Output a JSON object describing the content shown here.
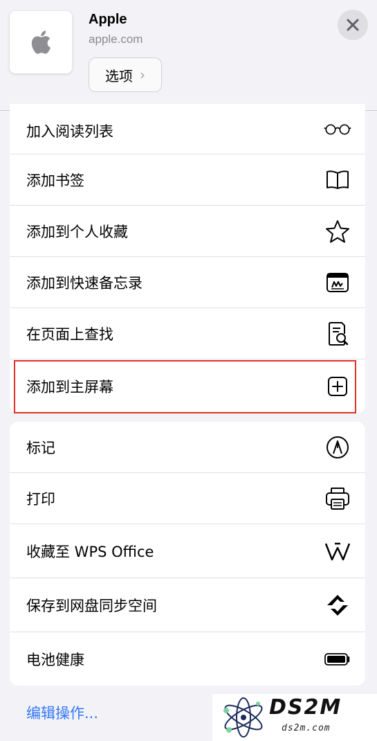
{
  "header": {
    "title": "Apple",
    "url": "apple.com",
    "options_label": "选项",
    "app_icon": "apple-logo-icon",
    "close_icon": "close-icon"
  },
  "menu_group_1": [
    {
      "label": "加入阅读列表",
      "icon": "glasses-icon"
    },
    {
      "label": "添加书签",
      "icon": "book-icon"
    },
    {
      "label": "添加到个人收藏",
      "icon": "star-icon"
    },
    {
      "label": "添加到快速备忘录",
      "icon": "quick-note-icon"
    },
    {
      "label": "在页面上查找",
      "icon": "find-in-page-icon"
    },
    {
      "label": "添加到主屏幕",
      "icon": "plus-square-icon",
      "highlighted": true
    }
  ],
  "menu_group_2": [
    {
      "label": "标记",
      "icon": "markup-pen-icon"
    },
    {
      "label": "打印",
      "icon": "printer-icon"
    },
    {
      "label": "收藏至 WPS Office",
      "icon": "wps-icon"
    },
    {
      "label": "保存到网盘同步空间",
      "icon": "sync-space-icon"
    },
    {
      "label": "电池健康",
      "icon": "battery-icon"
    }
  ],
  "footer": {
    "edit_actions_label": "编辑操作..."
  },
  "watermark": {
    "brand": "DS2M",
    "domain": "ds2m.com"
  },
  "colors": {
    "highlight_border": "#e0302a",
    "link": "#3478f6",
    "background": "#f2f2f7"
  }
}
